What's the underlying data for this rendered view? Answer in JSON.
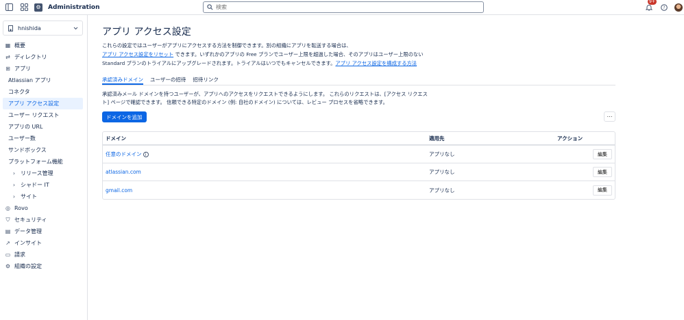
{
  "app": {
    "title": "Administration"
  },
  "search": {
    "placeholder": "検索"
  },
  "notifications": {
    "badge": "9+"
  },
  "sidebar": {
    "org_name": "hnishida",
    "items": [
      {
        "label": "概要",
        "icon": "overview-icon"
      },
      {
        "label": "ディレクトリ",
        "icon": "directory-icon"
      },
      {
        "label": "アプリ",
        "icon": "apps-icon"
      },
      {
        "label": "Atlassian アプリ"
      },
      {
        "label": "コネクタ"
      },
      {
        "label": "アプリ アクセス設定"
      },
      {
        "label": "ユーザー リクエスト"
      },
      {
        "label": "アプリの URL"
      },
      {
        "label": "ユーザー数"
      },
      {
        "label": "サンドボックス"
      },
      {
        "label": "プラットフォーム機能"
      },
      {
        "label": "リリース管理"
      },
      {
        "label": "シャドー IT"
      },
      {
        "label": "サイト"
      },
      {
        "label": "Rovo",
        "icon": "rovo-icon"
      },
      {
        "label": "セキュリティ",
        "icon": "shield-icon"
      },
      {
        "label": "データ管理",
        "icon": "database-icon"
      },
      {
        "label": "インサイト",
        "icon": "chart-icon"
      },
      {
        "label": "請求",
        "icon": "billing-icon"
      },
      {
        "label": "組織の設定",
        "icon": "gear-icon"
      }
    ]
  },
  "main": {
    "title": "アプリ アクセス設定",
    "desc_line1": "これらの設定ではユーザーがアプリにアクセスする方法を制御できます。別の組織にアプリを転送する場合は、",
    "desc_link1": "アプリ アクセス設定をリセット",
    "desc_line2": " できます。いずれかのアプリの Free プランでユーザー上限を超過した場合、そのアプリはユーザー上限のない",
    "desc_line3": "Standard プランのトライアルにアップグレードされます。トライアルはいつでもキャンセルできます。",
    "desc_link2": "アプリ アクセス設定を構成する方法",
    "tabs": [
      "承認済みドメイン",
      "ユーザーの招待",
      "招待リンク"
    ],
    "tab_desc": "承認済みメール ドメインを持つユーザーが、アプリへのアクセスをリクエストできるようにします。 これらのリクエストは、[アクセス リクエスト] ページで確認できます。 信頼できる特定のドメイン (例: 自社のドメイン) については、レビュー プロセスを省略できます。",
    "add_domain": "ドメインを追加",
    "more": "···",
    "table": {
      "headers": [
        "ドメイン",
        "適用先",
        "アクション"
      ],
      "rows": [
        {
          "domain": "任意のドメイン",
          "applies": "アプリなし",
          "action": "編集"
        },
        {
          "domain": "atlassian.com",
          "applies": "アプリなし",
          "action": "編集"
        },
        {
          "domain": "gmail.com",
          "applies": "アプリなし",
          "action": "編集"
        }
      ]
    }
  }
}
